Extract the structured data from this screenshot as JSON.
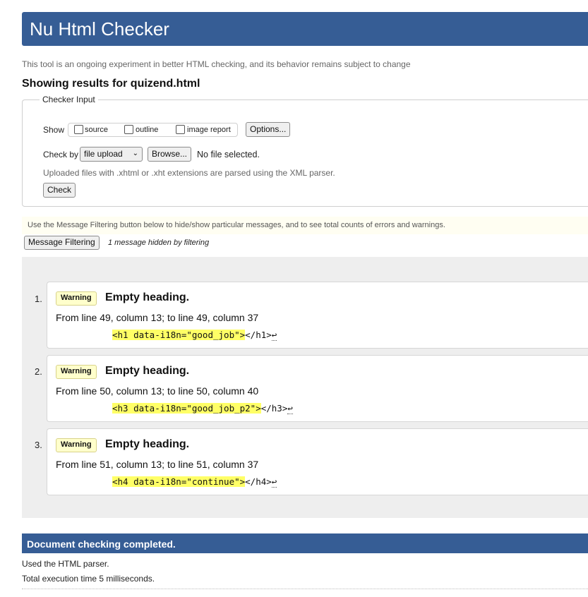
{
  "header": {
    "title": "Nu Html Checker"
  },
  "intro": "This tool is an ongoing experiment in better HTML checking, and its behavior remains subject to change",
  "showing": "Showing results for quizend.html",
  "checker_input": {
    "legend": "Checker Input",
    "show_label": "Show",
    "options": [
      {
        "label": "source",
        "checked": false
      },
      {
        "label": "outline",
        "checked": false
      },
      {
        "label": "image report",
        "checked": false
      }
    ],
    "options_button": "Options...",
    "check_by_label": "Check by",
    "check_by_value": "file upload",
    "browse_button": "Browse...",
    "no_file": "No file selected.",
    "hint": "Uploaded files with .xhtml or .xht extensions are parsed using the XML parser.",
    "check_button": "Check"
  },
  "filter": {
    "info": "Use the Message Filtering button below to hide/show particular messages, and to see total counts of errors and warnings.",
    "button": "Message Filtering",
    "hidden_note": "1 message hidden by filtering"
  },
  "messages": [
    {
      "num": "1.",
      "type": "Warning",
      "title": "Empty heading.",
      "location": "From line 49, column 13; to line 49, column 37",
      "code_tag": "<h1 data-i18n=\"good_job\">",
      "code_rest": "</h1>",
      "return_glyph": "↩"
    },
    {
      "num": "2.",
      "type": "Warning",
      "title": "Empty heading.",
      "location": "From line 50, column 13; to line 50, column 40",
      "code_tag": "<h3 data-i18n=\"good_job_p2\">",
      "code_rest": "</h3>",
      "return_glyph": "↩"
    },
    {
      "num": "3.",
      "type": "Warning",
      "title": "Empty heading.",
      "location": "From line 51, column 13; to line 51, column 37",
      "code_tag": "<h4 data-i18n=\"continue\">",
      "code_rest": "</h4>",
      "return_glyph": "↩"
    }
  ],
  "done": {
    "title": "Document checking completed.",
    "parser": "Used the HTML parser.",
    "time": "Total execution time 5 milliseconds."
  },
  "colors": {
    "header": "#365d95",
    "badge": "#ffffcc",
    "highlight": "#ffff66"
  }
}
